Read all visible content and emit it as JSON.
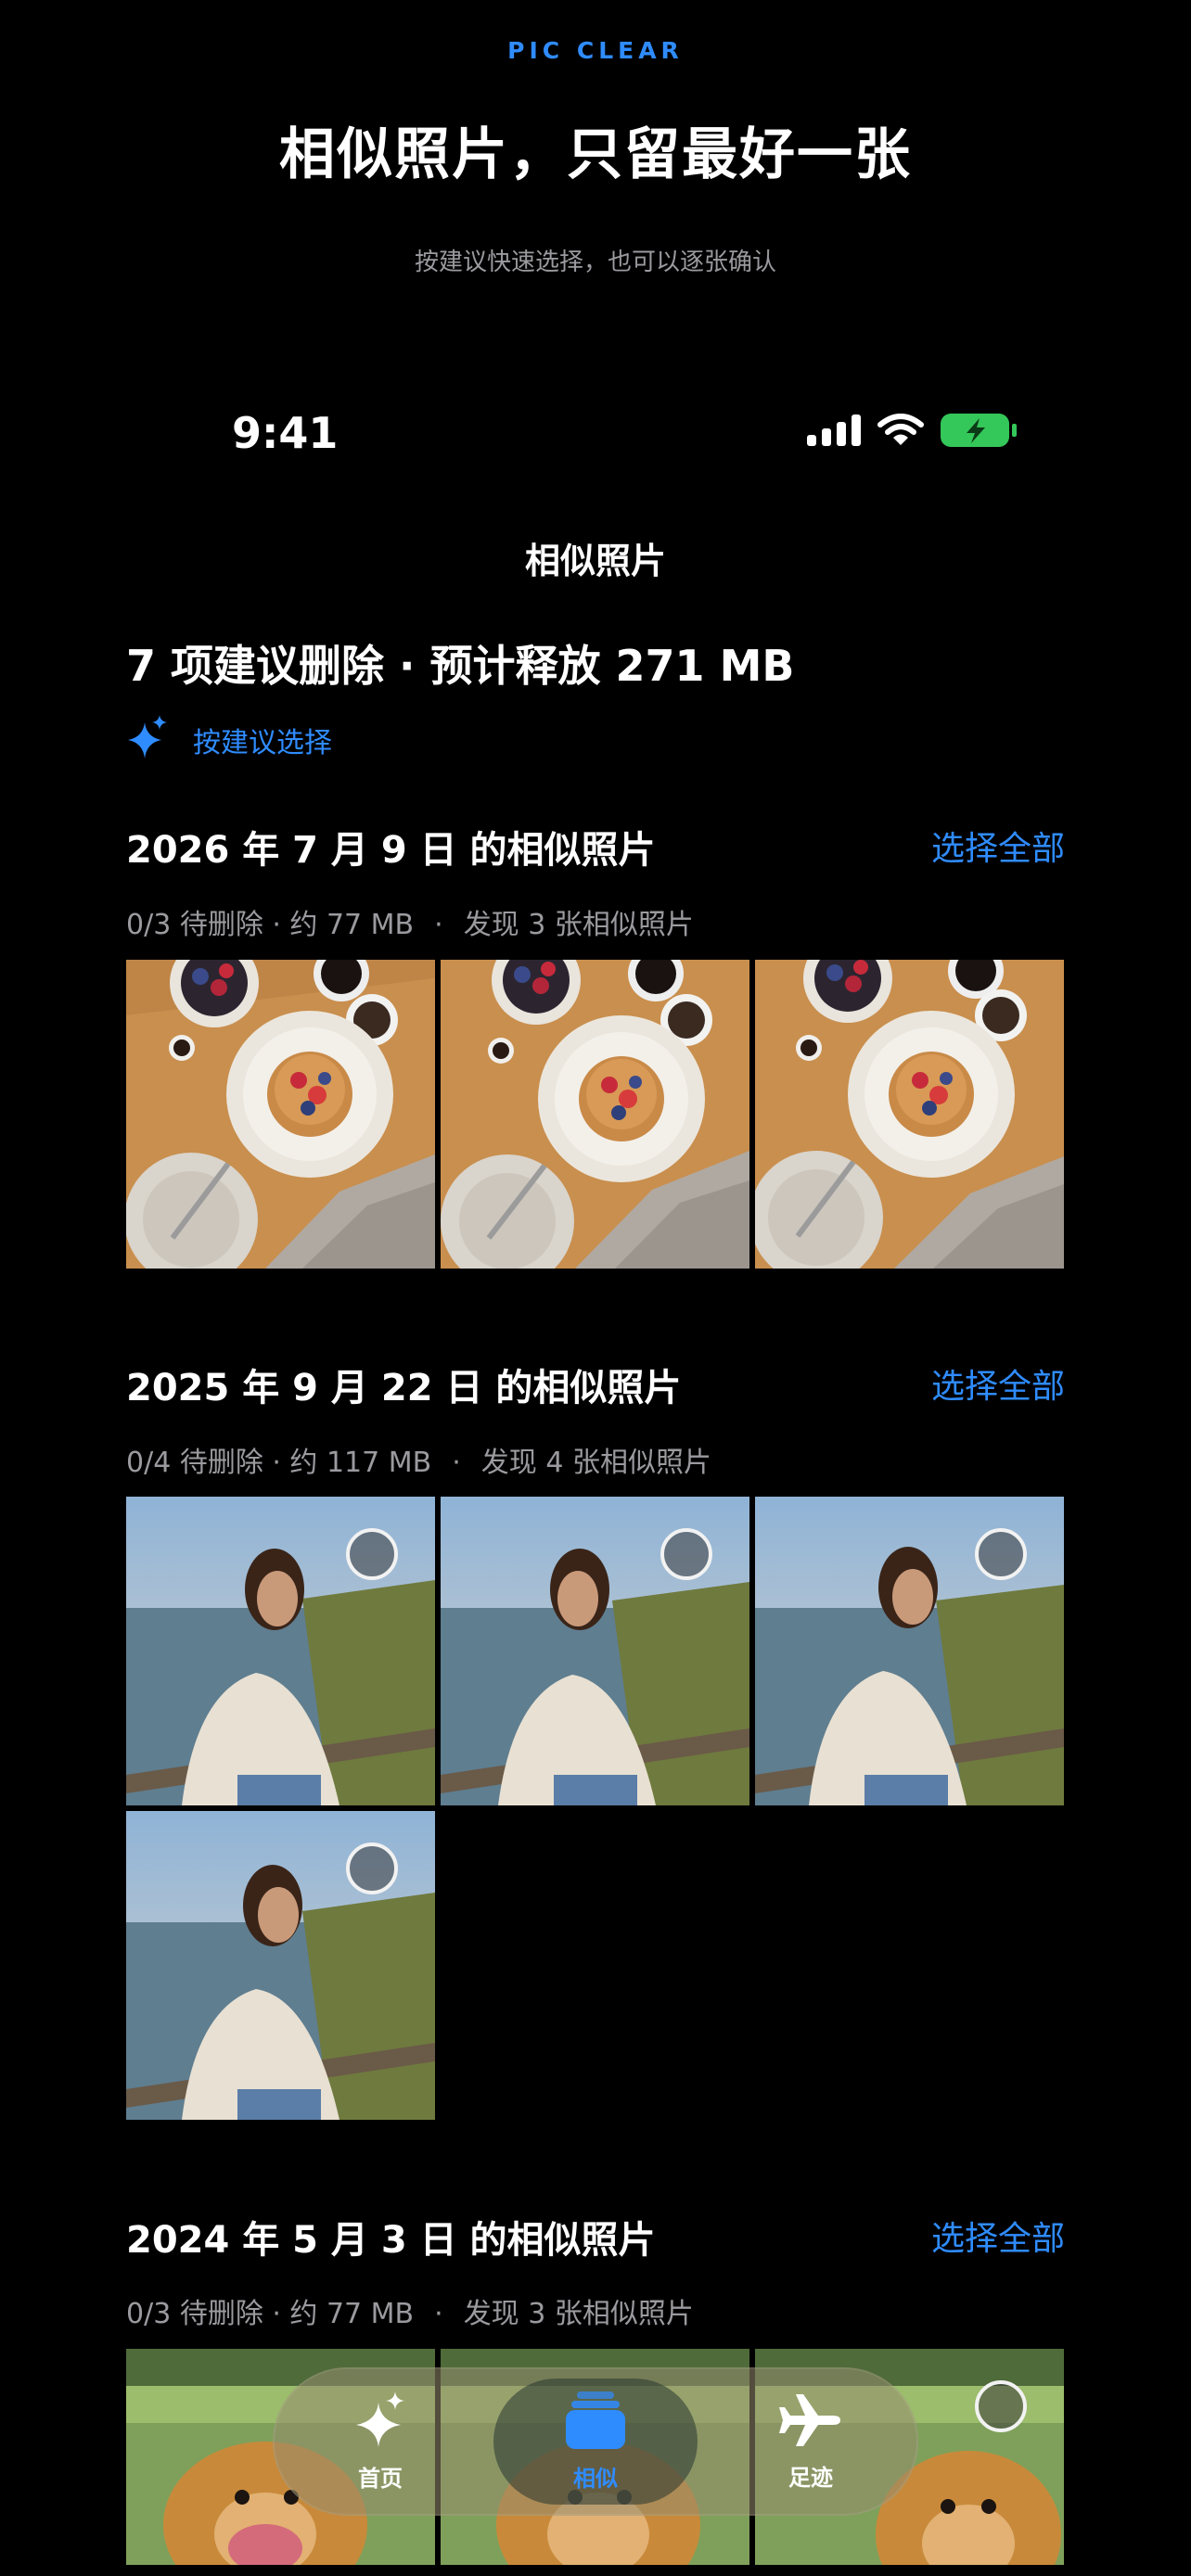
{
  "brand": "PIC CLEAR",
  "headline": "相似照片，只留最好一张",
  "subline": "按建议快速选择，也可以逐张确认",
  "status_bar": {
    "time": "9:41",
    "icons": [
      "signal-icon",
      "wifi-icon",
      "battery-charging-icon"
    ]
  },
  "nav": {
    "title": "相似照片"
  },
  "summary": "7 项建议删除 · 预计释放 271 MB",
  "suggest_button": {
    "label": "按建议选择",
    "icon": "sparkles-icon"
  },
  "sections": [
    {
      "title": "2026 年 7 月 9 日 的相似照片",
      "select_all": "选择全部",
      "pending": "0/3 待删除 · 约 77 MB",
      "found": "发现 3 张相似照片",
      "photo_count": 3,
      "subject": "breakfast"
    },
    {
      "title": "2025 年 9 月 22 日 的相似照片",
      "select_all": "选择全部",
      "pending": "0/4 待删除 · 约 117 MB",
      "found": "发现 4 张相似照片",
      "photo_count": 4,
      "subject": "portrait"
    },
    {
      "title": "2024 年 5 月 3 日 的相似照片",
      "select_all": "选择全部",
      "pending": "0/3 待删除 · 约 77 MB",
      "found": "发现 3 张相似照片",
      "photo_count": 3,
      "subject": "dog"
    }
  ],
  "tabbar": {
    "tabs": [
      {
        "label": "首页",
        "icon": "sparkles-icon",
        "active": false
      },
      {
        "label": "相似",
        "icon": "photo-stack-icon",
        "active": true
      },
      {
        "label": "足迹",
        "icon": "airplane-icon",
        "active": false
      }
    ]
  },
  "colors": {
    "accent": "#2F8CFF",
    "background": "#000000",
    "secondary_text": "#9A9A9F",
    "battery": "#34C759"
  }
}
